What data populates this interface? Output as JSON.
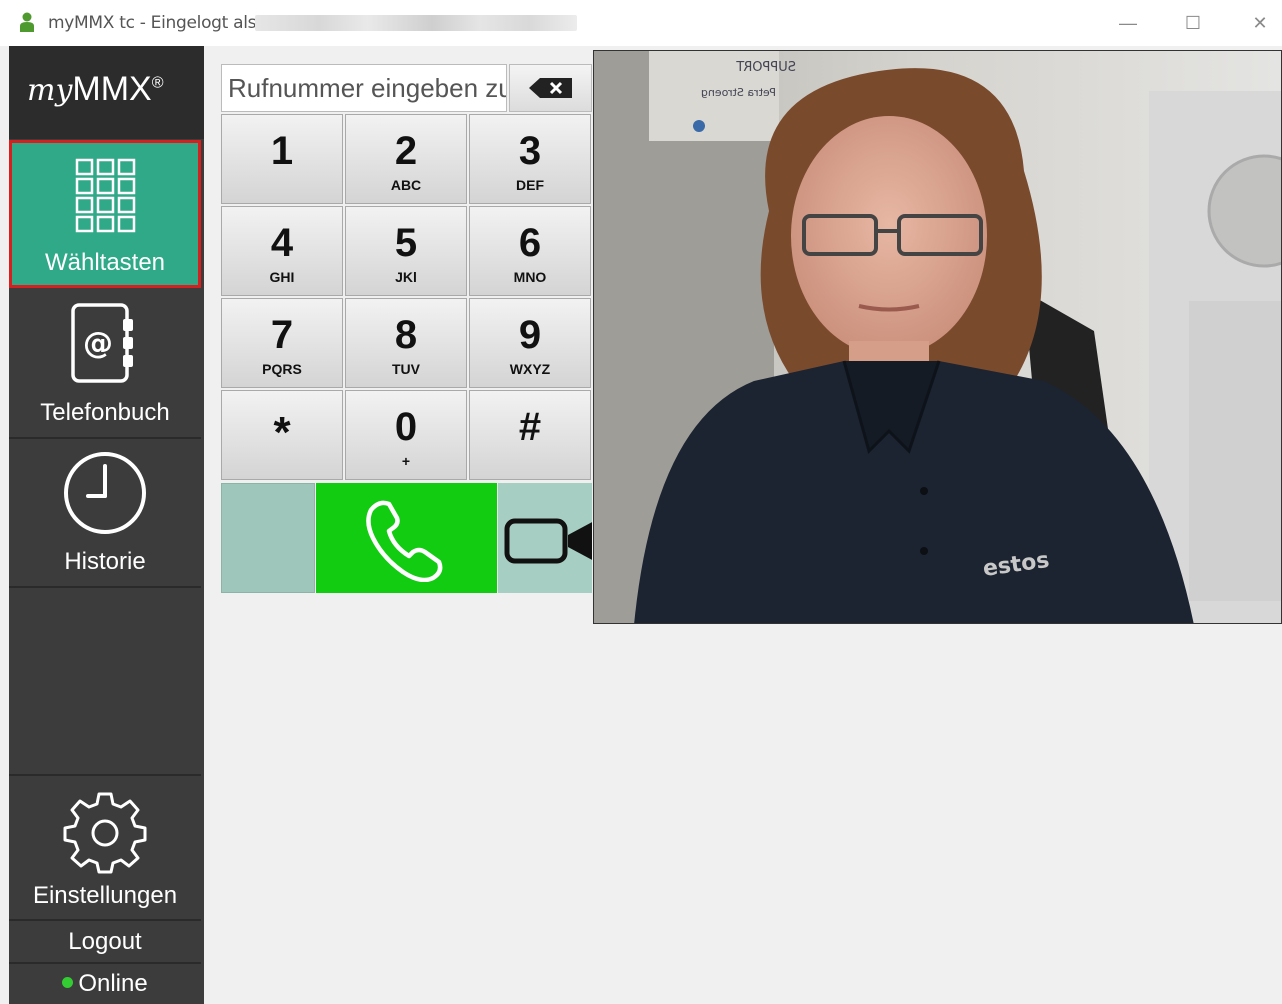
{
  "window": {
    "title": "myMMX tc - Eingelogt als",
    "minimize_glyph": "—",
    "maximize_glyph": "☐",
    "close_glyph": "✕"
  },
  "sidebar": {
    "logo_prefix": "my",
    "logo_main": "MMX",
    "logo_mark": "®",
    "items": [
      {
        "label": "Wähltasten",
        "icon": "keypad-icon",
        "active": true
      },
      {
        "label": "Telefonbuch",
        "icon": "address-book-icon"
      },
      {
        "label": "Historie",
        "icon": "clock-icon"
      },
      {
        "label": "Einstellungen",
        "icon": "gear-icon"
      },
      {
        "label": "Logout"
      },
      {
        "label": "Online",
        "status_color": "#33cc33"
      }
    ]
  },
  "dialer": {
    "input_placeholder": "Rufnummer eingeben zu",
    "input_value": "",
    "keys": [
      {
        "digit": "1",
        "letters": ""
      },
      {
        "digit": "2",
        "letters": "ABC"
      },
      {
        "digit": "3",
        "letters": "DEF"
      },
      {
        "digit": "4",
        "letters": "GHI"
      },
      {
        "digit": "5",
        "letters": "JKl"
      },
      {
        "digit": "6",
        "letters": "MNO"
      },
      {
        "digit": "7",
        "letters": "PQRS"
      },
      {
        "digit": "8",
        "letters": "TUV"
      },
      {
        "digit": "9",
        "letters": "WXYZ"
      },
      {
        "digit": "*",
        "letters": ""
      },
      {
        "digit": "0",
        "letters": "+"
      },
      {
        "digit": "#",
        "letters": ""
      }
    ]
  },
  "video_overlay": {
    "poster_line1": "SUPPORT",
    "poster_line2": "Petra Stroeng",
    "shirt_text": "estos"
  },
  "colors": {
    "accent_green": "#2fa987",
    "call_green": "#12cc12",
    "active_border": "#d62020",
    "sidebar_bg": "#3c3c3c"
  }
}
